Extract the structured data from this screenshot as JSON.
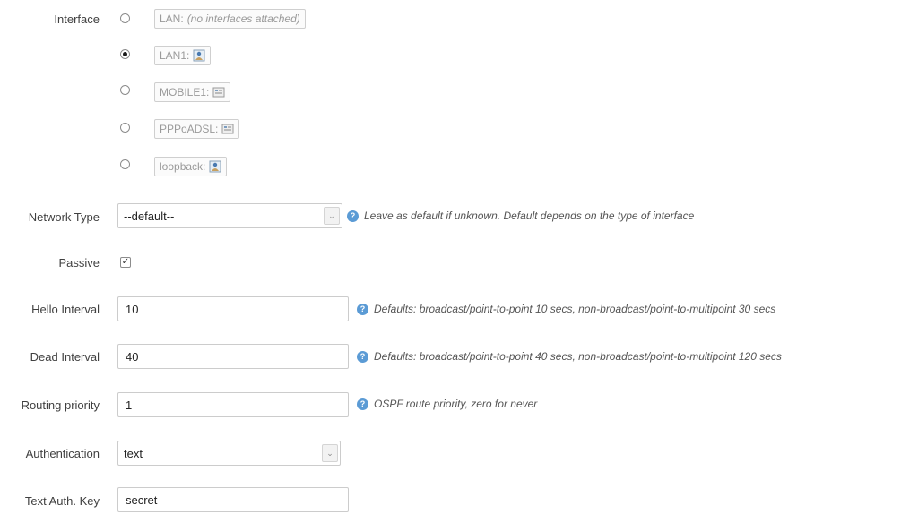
{
  "interface": {
    "label": "Interface",
    "options": [
      {
        "name": "LAN:",
        "note": "(no interfaces attached)",
        "icon": "",
        "checked": false
      },
      {
        "name": "LAN1:",
        "note": "",
        "icon": "network-user-icon",
        "checked": true
      },
      {
        "name": "MOBILE1:",
        "note": "",
        "icon": "network-device-icon",
        "checked": false
      },
      {
        "name": "PPPoADSL:",
        "note": "",
        "icon": "network-device-icon",
        "checked": false
      },
      {
        "name": "loopback:",
        "note": "",
        "icon": "network-user-icon",
        "checked": false
      }
    ]
  },
  "network_type": {
    "label": "Network Type",
    "value": "--default--",
    "help": "Leave as default if unknown. Default depends on the type of interface"
  },
  "passive": {
    "label": "Passive",
    "checked": true
  },
  "hello_interval": {
    "label": "Hello Interval",
    "value": "10",
    "help": "Defaults: broadcast/point-to-point 10 secs, non-broadcast/point-to-multipoint 30 secs"
  },
  "dead_interval": {
    "label": "Dead Interval",
    "value": "40",
    "help": "Defaults: broadcast/point-to-point 40 secs, non-broadcast/point-to-multipoint 120 secs"
  },
  "routing_priority": {
    "label": "Routing priority",
    "value": "1",
    "help": "OSPF route priority, zero for never"
  },
  "authentication": {
    "label": "Authentication",
    "value": "text"
  },
  "text_auth_key": {
    "label": "Text Auth. Key",
    "value": "secret"
  },
  "colors": {
    "help_icon": "#5b9bd5",
    "border": "#cccccc"
  }
}
